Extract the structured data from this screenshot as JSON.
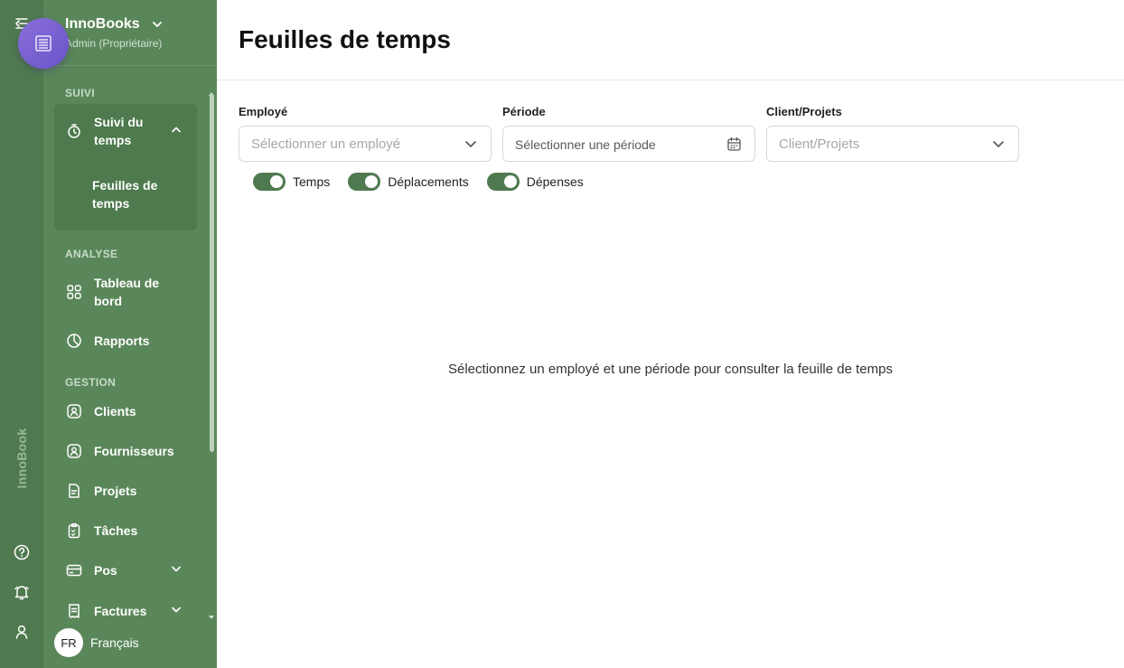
{
  "org": {
    "name": "InnoBooks",
    "role": "Admin (Propriétaire)"
  },
  "rail": {
    "brand": "InnoBook"
  },
  "sidebar": {
    "sections": {
      "suivi": "SUIVI",
      "analyse": "ANALYSE",
      "gestion": "GESTION"
    },
    "items": {
      "time_tracking": "Suivi du temps",
      "timesheets": "Feuilles de temps",
      "dashboard": "Tableau de bord",
      "reports": "Rapports",
      "clients": "Clients",
      "suppliers": "Fournisseurs",
      "projects": "Projets",
      "tasks": "Tâches",
      "pos": "Pos",
      "invoices": "Factures"
    },
    "language": {
      "code": "FR",
      "label": "Français"
    }
  },
  "main": {
    "title": "Feuilles de temps",
    "filters": {
      "employee": {
        "label": "Employé",
        "placeholder": "Sélectionner un employé"
      },
      "period": {
        "label": "Période",
        "placeholder": "Sélectionner une période"
      },
      "client": {
        "label": "Client/Projets",
        "placeholder": "Client/Projets"
      }
    },
    "toggles": [
      {
        "label": "Temps",
        "on": true
      },
      {
        "label": "Déplacements",
        "on": true
      },
      {
        "label": "Dépenses",
        "on": true
      }
    ],
    "empty_message": "Sélectionnez un employé et une période pour consulter la feuille de temps"
  },
  "colors": {
    "sidebar": "#5a875a",
    "rail": "#4f7a4f",
    "toggle": "#4f7a4f",
    "fab": "#7a62d4"
  }
}
